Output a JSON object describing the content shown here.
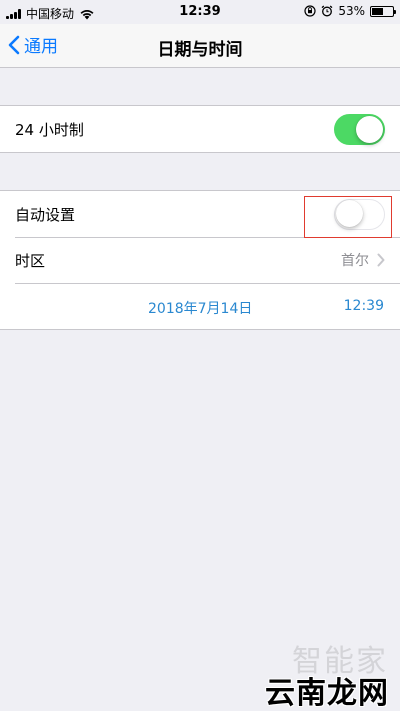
{
  "status_bar": {
    "carrier": "中国移动",
    "time": "12:39",
    "battery_percent": "53%",
    "battery_level": 0.53,
    "icons": [
      "signal-icon",
      "wifi-icon",
      "orientation-lock-icon",
      "alarm-icon",
      "battery-icon"
    ]
  },
  "nav": {
    "back_label": "通用",
    "title": "日期与时间"
  },
  "settings": {
    "hour24": {
      "label": "24 小时制",
      "on": true
    },
    "auto_set": {
      "label": "自动设置",
      "on": false
    },
    "timezone": {
      "label": "时区",
      "value": "首尔"
    },
    "date": "2018年7月14日",
    "time": "12:39"
  },
  "colors": {
    "accent": "#0a7aff",
    "toggle_on": "#4cd964",
    "highlight": "#e03b2f",
    "background": "#efeff4"
  },
  "watermark": {
    "top": "智能家",
    "bottom": "云南龙网"
  }
}
